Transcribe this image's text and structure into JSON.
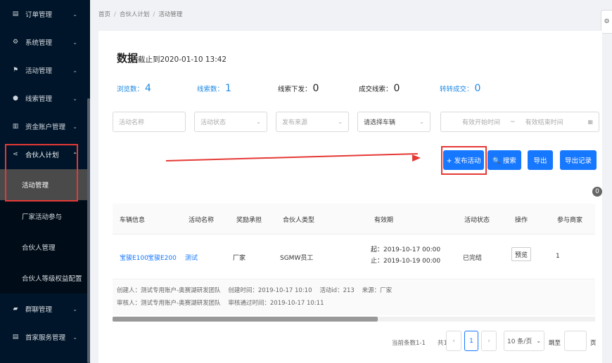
{
  "sidebar": {
    "items": [
      {
        "icon": "document-icon",
        "label": "订单管理"
      },
      {
        "icon": "gear-icon",
        "label": "系统管理"
      },
      {
        "icon": "flag-icon",
        "label": "活动管理"
      },
      {
        "icon": "dot-icon",
        "label": "线索管理"
      },
      {
        "icon": "bank-icon",
        "label": "资金账户管理"
      },
      {
        "icon": "share-icon",
        "label": "合伙人计划"
      },
      {
        "icon": "folder-icon",
        "label": "群聊管理"
      },
      {
        "icon": "document-icon",
        "label": "首家服务管理"
      }
    ],
    "subitems": [
      "活动管理",
      "厂家活动参与",
      "合伙人管理",
      "合伙人等级权益配置"
    ]
  },
  "breadcrumb": [
    "首页",
    "合伙人计划",
    "活动管理"
  ],
  "page": {
    "title": "数据",
    "subtitle": "截止到2020-01-10 13:42"
  },
  "stats": [
    {
      "label": "浏览数：",
      "value": "4"
    },
    {
      "label": "线索数：",
      "value": "1"
    },
    {
      "label": "线索下发：",
      "value": "0"
    },
    {
      "label": "成交线索：",
      "value": "0"
    },
    {
      "label": "转转成交：",
      "value": "0"
    }
  ],
  "filters": {
    "name_placeholder": "活动名称",
    "status_placeholder": "活动状态",
    "source_placeholder": "发布来源",
    "vehicle": "请选择车辆",
    "start_placeholder": "有效开始时间",
    "range_sep": "~",
    "end_placeholder": "有效结束时间"
  },
  "buttons": {
    "publish": "+ 发布活动",
    "search": "🔍 搜索",
    "export": "导出",
    "export_log": "导出记录"
  },
  "badge_count": "0",
  "table": {
    "headers": [
      "车辆信息",
      "活动名称",
      "奖励承担",
      "合伙人类型",
      "有效期",
      "活动状态",
      "操作",
      "参与商家"
    ],
    "row": {
      "vehicle_1": "宝骏E100",
      "vehicle_2": "宝骏E200",
      "name": "测试",
      "bearer": "厂家",
      "partner_type": "SGMW员工",
      "start": "起：2019-10-17 00:00",
      "end": "止：2019-10-19 00:00",
      "status": "已完结",
      "action": "预览",
      "merchants": "1"
    },
    "meta": {
      "creator": "创建人：测试专用账户-奥赛湖研发团队",
      "create_time": "创建时间：2019-10-17 10:10",
      "activity_id": "活动id：213",
      "source": "来源：厂家",
      "auditor": "审核人：测试专用账户-奥赛湖研发团队",
      "audit_time": "审核通过时间：2019-10-17 10:11"
    }
  },
  "pagination": {
    "range": "当前条数1-1",
    "total": "共1条",
    "prev": "‹",
    "current": "1",
    "next": "›",
    "size": "10 条/页",
    "jump_label": "跳至",
    "page_unit": "页"
  },
  "colors": {
    "sidebar_bg": "#001529",
    "primary": "#1677ff",
    "annotation": "#e53935"
  }
}
